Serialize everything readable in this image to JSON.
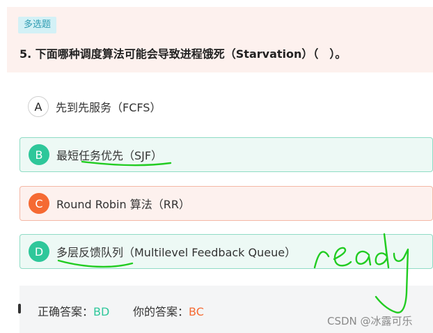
{
  "question": {
    "type_tag": "多选题",
    "title": "5. 下面哪种调度算法可能会导致进程饿死（Starvation）（　）。"
  },
  "options": [
    {
      "letter": "A",
      "text": "先到先服务（FCFS）",
      "state": "plain"
    },
    {
      "letter": "B",
      "text": "最短任务优先（SJF）",
      "state": "correct"
    },
    {
      "letter": "C",
      "text": "Round Robin 算法（RR）",
      "state": "wrong"
    },
    {
      "letter": "D",
      "text": "多层反馈队列（Multilevel Feedback Queue）",
      "state": "correct"
    }
  ],
  "answer": {
    "correct_label": "正确答案：",
    "correct_value": "BD",
    "yours_label": "你的答案：",
    "yours_value": "BC"
  },
  "handwriting": "ready",
  "watermark": "CSDN @冰露可乐",
  "colors": {
    "correct": "#2ec79a",
    "wrong": "#f56a33",
    "ink": "#22cc22",
    "tag_bg": "#d3f1f6",
    "header_bg": "#fdf1ee"
  }
}
